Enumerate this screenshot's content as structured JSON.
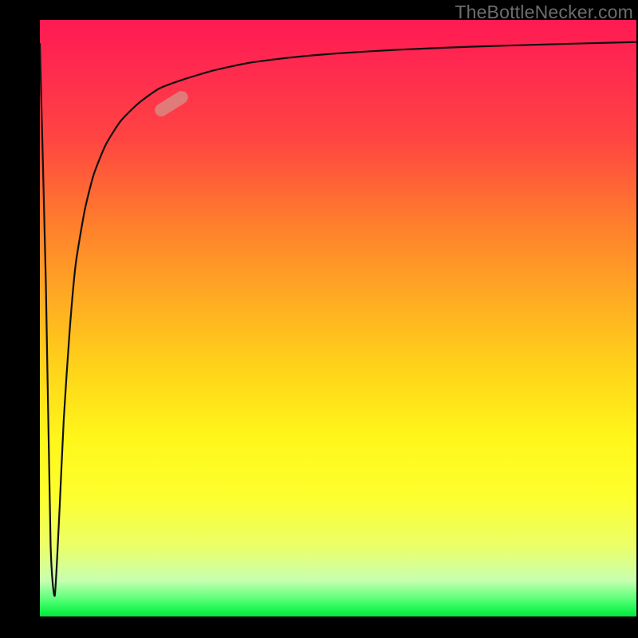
{
  "watermark": {
    "text": "TheBottleNecker.com"
  },
  "colors": {
    "frame": "#000000",
    "curve": "#111111",
    "marker_fill": "rgba(210,150,140,0.72)"
  },
  "marker": {
    "x_pct": 0.22,
    "y_pct": 0.86,
    "rotation_deg": -32
  },
  "chart_data": {
    "type": "line",
    "title": "",
    "xlabel": "",
    "ylabel": "",
    "xlim": [
      0,
      1
    ],
    "ylim": [
      0,
      1
    ],
    "grid": false,
    "legend": false,
    "annotations": [
      {
        "type": "marker",
        "x": 0.22,
        "y": 0.86
      }
    ],
    "series": [
      {
        "name": "curve",
        "x": [
          0.0,
          0.01,
          0.018,
          0.025,
          0.033,
          0.04,
          0.05,
          0.06,
          0.075,
          0.09,
          0.11,
          0.135,
          0.165,
          0.2,
          0.24,
          0.29,
          0.35,
          0.42,
          0.5,
          0.6,
          0.72,
          0.85,
          1.0
        ],
        "y": [
          0.96,
          0.56,
          0.12,
          0.035,
          0.18,
          0.33,
          0.48,
          0.59,
          0.68,
          0.74,
          0.79,
          0.83,
          0.86,
          0.885,
          0.9,
          0.915,
          0.928,
          0.937,
          0.944,
          0.95,
          0.955,
          0.959,
          0.963
        ]
      }
    ]
  }
}
